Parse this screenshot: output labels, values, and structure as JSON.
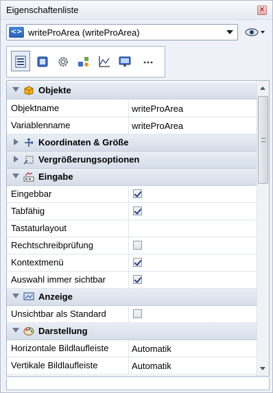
{
  "window": {
    "title": "Eigenschaftenliste"
  },
  "selector": {
    "type_icon": "<>",
    "value": "writeProArea (writeProArea)"
  },
  "tabs": [
    {
      "name": "list"
    },
    {
      "name": "form"
    },
    {
      "name": "gear"
    },
    {
      "name": "objects"
    },
    {
      "name": "chart"
    },
    {
      "name": "display"
    },
    {
      "name": "more"
    }
  ],
  "categories": {
    "objekte": "Objekte",
    "koordinaten": "Koordinaten & Größe",
    "vergroesserung": "Vergrößerungsoptionen",
    "eingabe": "Eingabe",
    "anzeige": "Anzeige",
    "darstellung": "Darstellung"
  },
  "props": {
    "objektname": {
      "label": "Objektname",
      "value": "writeProArea"
    },
    "variablenname": {
      "label": "Variablenname",
      "value": "writeProArea"
    },
    "eingebbar": {
      "label": "Eingebbar",
      "checked": true
    },
    "tabfaehig": {
      "label": "Tabfähig",
      "checked": true
    },
    "tastaturlayout": {
      "label": "Tastaturlayout",
      "value": ""
    },
    "rechtschreib": {
      "label": "Rechtschreibprüfung",
      "checked": false
    },
    "kontextmenu": {
      "label": "Kontextmenü",
      "checked": true
    },
    "auswahl": {
      "label": "Auswahl immer sichtbar",
      "checked": true
    },
    "unsichtbar": {
      "label": "Unsichtbar als Standard",
      "checked": false
    },
    "hscroll": {
      "label": "Horizontale Bildlaufleiste",
      "value": "Automatik"
    },
    "vscroll": {
      "label": "Vertikale Bildlaufleiste",
      "value": "Automatik"
    }
  }
}
